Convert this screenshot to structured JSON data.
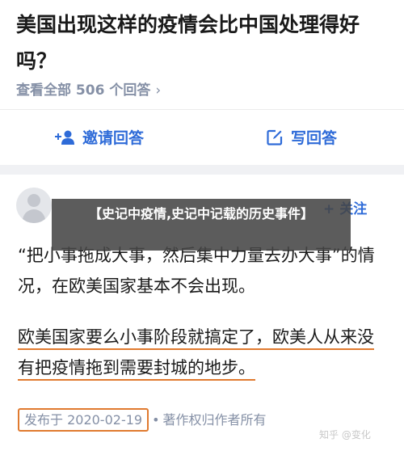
{
  "question": {
    "title": "美国出现这样的疫情会比中国处理得好吗？",
    "view_all": "查看全部 506 个回答",
    "chevron": "›"
  },
  "actions": {
    "invite_label": "邀请回答",
    "write_label": "写回答"
  },
  "answer": {
    "follow_plus": "+",
    "follow_label": "关注",
    "overlay_text": "【史记中疫情,史记中记载的历史事件】",
    "para1": "“把小事拖成大事，然后集中力量去办大事”的情况，在欧美国家基本不会出现。",
    "para2": "欧美国家要么小事阶段就搞定了，欧美人从来没有把疫情拖到需要封城的地步。",
    "date": "发布于 2020-02-19",
    "dot": "•",
    "copyright": "著作权归作者所有"
  },
  "watermark": "知乎 @变化",
  "colors": {
    "accent": "#2e6bd8",
    "highlight": "#e07a2f",
    "meta": "#8590a6"
  }
}
